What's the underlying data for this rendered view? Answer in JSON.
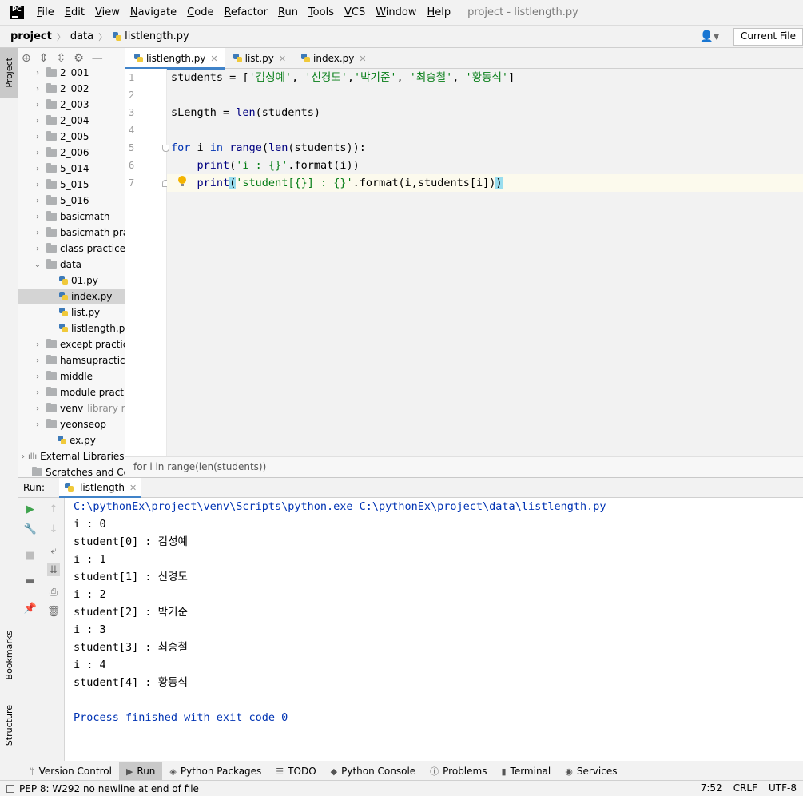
{
  "app": {
    "logo_text": "PC",
    "window_title": "project - listlength.py"
  },
  "menu": [
    "File",
    "Edit",
    "View",
    "Navigate",
    "Code",
    "Refactor",
    "Run",
    "Tools",
    "VCS",
    "Window",
    "Help"
  ],
  "breadcrumb": [
    "project",
    "data",
    "listlength.py"
  ],
  "run_config": "Current File",
  "left_strip": {
    "project": "Project",
    "bookmarks": "Bookmarks",
    "structure": "Structure"
  },
  "tree": [
    {
      "label": "2_001",
      "type": "folder"
    },
    {
      "label": "2_002",
      "type": "folder"
    },
    {
      "label": "2_003",
      "type": "folder"
    },
    {
      "label": "2_004",
      "type": "folder"
    },
    {
      "label": "2_005",
      "type": "folder"
    },
    {
      "label": "2_006",
      "type": "folder"
    },
    {
      "label": "5_014",
      "type": "folder"
    },
    {
      "label": "5_015",
      "type": "folder"
    },
    {
      "label": "5_016",
      "type": "folder"
    },
    {
      "label": "basicmath",
      "type": "folder"
    },
    {
      "label": "basicmath prac",
      "type": "folder"
    },
    {
      "label": "class practice",
      "type": "folder"
    },
    {
      "label": "data",
      "type": "folder-open"
    },
    {
      "label": "01.py",
      "type": "file"
    },
    {
      "label": "index.py",
      "type": "file",
      "selected": true
    },
    {
      "label": "list.py",
      "type": "file"
    },
    {
      "label": "listlength.py",
      "type": "file"
    },
    {
      "label": "except practice",
      "type": "folder"
    },
    {
      "label": "hamsupractice",
      "type": "folder"
    },
    {
      "label": "middle",
      "type": "folder"
    },
    {
      "label": "module practic",
      "type": "folder"
    },
    {
      "label": "venv",
      "type": "folder",
      "tag": "library ro"
    },
    {
      "label": "yeonseop",
      "type": "folder"
    },
    {
      "label": "ex.py",
      "type": "file-root"
    },
    {
      "label": "External Libraries",
      "type": "libs"
    },
    {
      "label": "Scratches and Cor",
      "type": "scratch"
    }
  ],
  "editor_tabs": [
    {
      "label": "listlength.py",
      "active": true
    },
    {
      "label": "list.py",
      "active": false
    },
    {
      "label": "index.py",
      "active": false
    }
  ],
  "line_numbers": [
    "1",
    "2",
    "3",
    "4",
    "5",
    "6",
    "7"
  ],
  "code": {
    "l1_var": "students = [",
    "l1_s1": "'김성예'",
    "l1_c1": ", ",
    "l1_s2": "'신경도'",
    "l1_c2": ",",
    "l1_s3": "'박기준'",
    "l1_c3": ", ",
    "l1_s4": "'최승철'",
    "l1_c4": ", ",
    "l1_s5": "'황동석'",
    "l1_end": "]",
    "l3_pre": "sLength = ",
    "l3_fn": "len",
    "l3_rest": "(students)",
    "l5_for": "for",
    "l5_i": " i ",
    "l5_in": "in",
    "l5_sp": " ",
    "l5_range": "range",
    "l5_op": "(",
    "l5_len": "len",
    "l5_rest": "(students)):",
    "l6_indent": "    ",
    "l6_print": "print",
    "l6_op": "(",
    "l6_str": "'i : {}'",
    "l6_rest": ".format(i))",
    "l7_indent": "    ",
    "l7_print": "print",
    "l7_op": "(",
    "l7_str": "'student[{}] : {}'",
    "l7_rest": ".format(i,students[i])",
    "l7_close": ")"
  },
  "editor_breadcrumb": "for i in range(len(students))",
  "run": {
    "label": "Run:",
    "tab": "listlength"
  },
  "console": {
    "command": "C:\\pythonEx\\project\\venv\\Scripts\\python.exe C:\\pythonEx\\project\\data\\listlength.py",
    "lines": [
      "i : 0",
      "student[0] : 김성예",
      "i : 1",
      "student[1] : 신경도",
      "i : 2",
      "student[2] : 박기준",
      "i : 3",
      "student[3] : 최승철",
      "i : 4",
      "student[4] : 황동석"
    ],
    "exit": "Process finished with exit code 0"
  },
  "bottom_tabs": [
    {
      "label": "Version Control",
      "icon": "branch-icon"
    },
    {
      "label": "Run",
      "icon": "play-icon",
      "active": true
    },
    {
      "label": "Python Packages",
      "icon": "layers-icon"
    },
    {
      "label": "TODO",
      "icon": "list-icon"
    },
    {
      "label": "Python Console",
      "icon": "python-icon"
    },
    {
      "label": "Problems",
      "icon": "info-icon"
    },
    {
      "label": "Terminal",
      "icon": "terminal-icon"
    },
    {
      "label": "Services",
      "icon": "services-icon"
    }
  ],
  "status": {
    "message": "PEP 8: W292 no newline at end of file",
    "position": "7:52",
    "line_sep": "CRLF",
    "encoding": "UTF-8"
  }
}
